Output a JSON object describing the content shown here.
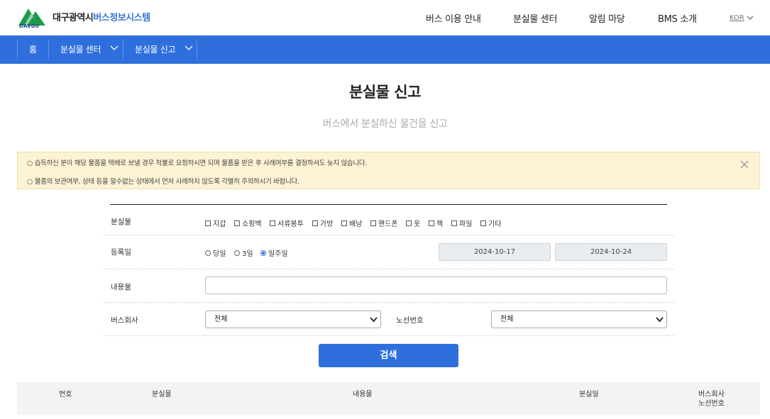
{
  "header": {
    "logo_text": "DAEGU",
    "site_title_main": "대구광역시",
    "site_title_accent": "버스정보시스템",
    "gnb": [
      "버스 이용 안내",
      "분실물 센터",
      "알림 마당",
      "BMS 소개"
    ],
    "lang": "KOR",
    "colors": {
      "brand_green": "#1f9a4a",
      "accent_blue": "#3a74d6"
    }
  },
  "navbar": {
    "color": "#2f6fdd",
    "home": "홈",
    "crumbs": [
      "분실물 센터",
      "분실물 신고"
    ]
  },
  "page": {
    "title": "분실물 신고",
    "subtitle": "버스에서 분실하신 물건을 신고"
  },
  "notice": {
    "lines": [
      "○ 습득하신 분이 해당 물품을 택배로 보낼 경우 착불로 요청하시면 되며 물품을 받은 후 사례여부를 결정하셔도 늦지 않습니다.",
      "○ 물품의 보관여부, 상태 등을 알수없는 상태에서 먼저 사례하지 않도록 각별히 주의하시기 바랍니다."
    ]
  },
  "form": {
    "item_label": "분실물",
    "item_types": [
      "지갑",
      "쇼핑백",
      "서류봉투",
      "가방",
      "배낭",
      "핸드폰",
      "옷",
      "책",
      "파일",
      "기타"
    ],
    "date_label": "등록일",
    "date_ranges": [
      "당일",
      "3일",
      "일주일"
    ],
    "selected_range": "일주일",
    "date_from": "2024-10-17",
    "date_to": "2024-10-24",
    "content_label": "내용물",
    "content_value": "",
    "company_label": "버스회사",
    "company_value": "전체",
    "route_label": "노선번호",
    "route_value": "전체",
    "search_button": "검색"
  },
  "table": {
    "headers": [
      "번호",
      "분실물",
      "내용물",
      "분실일"
    ],
    "last_header_line1": "버스회사",
    "last_header_line2": "노선번호"
  }
}
